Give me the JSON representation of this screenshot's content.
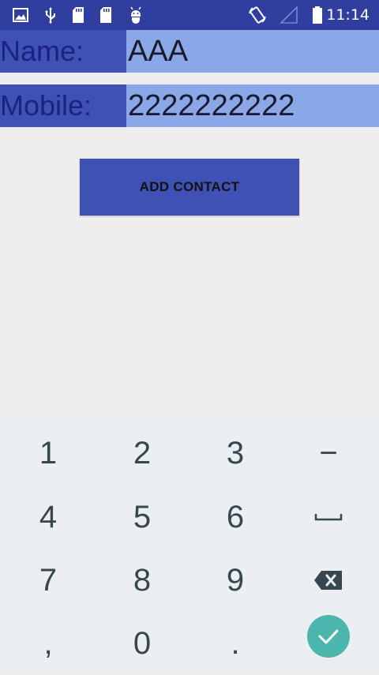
{
  "status_bar": {
    "time": "11:14",
    "left_icons": [
      "image-icon",
      "usb-icon",
      "sd-card-icon",
      "sd-card-icon",
      "android-debug-icon"
    ],
    "right_icons": [
      "screen-rotation-icon",
      "signal-icon",
      "battery-icon"
    ],
    "background": "#303f9f"
  },
  "form": {
    "name_label": "Name:",
    "name_value": "AAA",
    "mobile_label": "Mobile:",
    "mobile_value": "2222222222"
  },
  "button": {
    "label": "ADD CONTACT",
    "color": "#3f51b5"
  },
  "keyboard": {
    "keys": [
      [
        "1",
        "2",
        "3",
        "−"
      ],
      [
        "4",
        "5",
        "6",
        "space"
      ],
      [
        "7",
        "8",
        "9",
        "backspace"
      ],
      [
        ",",
        "0",
        ".",
        "enter"
      ]
    ],
    "enter_color": "#4db6ac"
  }
}
